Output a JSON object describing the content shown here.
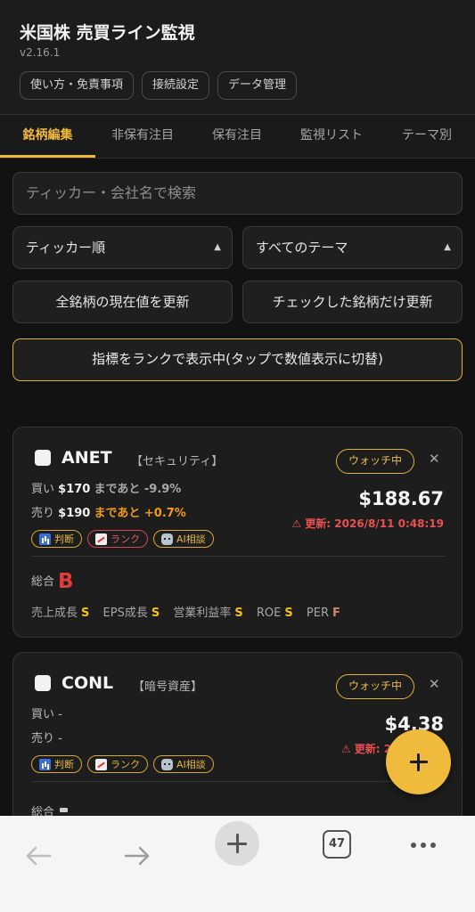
{
  "header": {
    "title": "米国株 売買ライン監視",
    "version": "v2.16.1",
    "buttons": [
      "使い方・免責事項",
      "接続設定",
      "データ管理"
    ]
  },
  "tabs": [
    "銘柄編集",
    "非保有注目",
    "保有注目",
    "監視リスト",
    "テーマ別"
  ],
  "active_tab": "銘柄編集",
  "accent_color": "#f0b93a",
  "search": {
    "placeholder": "ティッカー・会社名で検索"
  },
  "sort_select": "ティッカー順",
  "theme_select": "すべてのテーマ",
  "actions": {
    "update_all": "全銘柄の現在値を更新",
    "update_checked": "チェックした銘柄だけ更新",
    "rank_toggle": "指標をランクで表示中(タップで数値表示に切替)"
  },
  "cards": [
    {
      "ticker": "ANET",
      "theme": "【セキュリティ】",
      "status": "ウォッチ中",
      "buy_label": "買い",
      "buy_price": "$170",
      "buy_remaining": "まであと -9.9%",
      "sell_label": "売り",
      "sell_price": "$190",
      "sell_remaining": "まであと +0.7%",
      "price": "$188.67",
      "updated": "⚠ 更新: 2026/8/11 0:48:19",
      "chips": [
        "判断",
        "ランク",
        "AI相談"
      ],
      "overall_label": "総合",
      "overall_grade": "B",
      "metrics": [
        {
          "name": "売上成長",
          "grade": "S"
        },
        {
          "name": "EPS成長",
          "grade": "S"
        },
        {
          "name": "営業利益率",
          "grade": "S"
        },
        {
          "name": "ROE",
          "grade": "S"
        },
        {
          "name": "PER",
          "grade": "F"
        }
      ]
    },
    {
      "ticker": "CONL",
      "theme": "【暗号資産】",
      "status": "ウォッチ中",
      "buy_label": "買い -",
      "sell_label": "売り -",
      "price": "$4.38",
      "updated": "⚠ 更新: 2026/8/11",
      "chips": [
        "判断",
        "ランク",
        "AI相談"
      ],
      "overall_label": "総合"
    }
  ],
  "browser": {
    "tab_count": "47"
  },
  "icons": [
    "bar-chart-icon",
    "trend-chart-icon",
    "robot-icon",
    "close-icon",
    "plus-icon",
    "back-arrow-icon",
    "forward-arrow-icon",
    "more-icon"
  ]
}
